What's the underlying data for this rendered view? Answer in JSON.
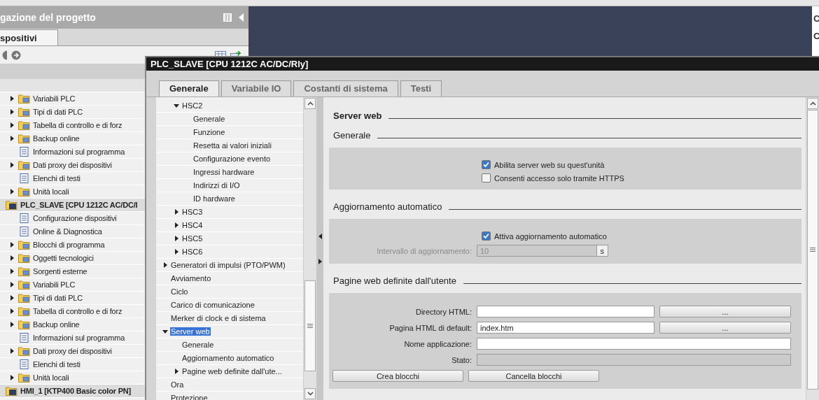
{
  "project_panel": {
    "title": "gazione del progetto",
    "tab": "spositivi",
    "tree": [
      {
        "children": [
          {
            "label": "Variabili PLC",
            "kind": "folder",
            "expanded": false
          },
          {
            "label": "Tipi di dati PLC",
            "kind": "folder",
            "expanded": false
          },
          {
            "label": "Tabella di controllo e di forz",
            "kind": "folder",
            "expanded": false
          },
          {
            "label": "Backup online",
            "kind": "folder",
            "expanded": false
          },
          {
            "label": "Informazioni sul programma",
            "kind": "document"
          },
          {
            "label": "Dati proxy dei dispositivi",
            "kind": "folder",
            "expanded": false
          },
          {
            "label": "Elenchi di testi",
            "kind": "document"
          },
          {
            "label": "Unità locali",
            "kind": "folder",
            "expanded": false
          }
        ]
      },
      {
        "label": "PLC_SLAVE [CPU 1212C AC/DC/I",
        "kind": "device",
        "children": [
          {
            "label": "Configurazione dispositivi",
            "kind": "document"
          },
          {
            "label": "Online & Diagnostica",
            "kind": "document"
          },
          {
            "label": "Blocchi di programma",
            "kind": "folder",
            "expanded": false
          },
          {
            "label": "Oggetti tecnologici",
            "kind": "folder",
            "expanded": false
          },
          {
            "label": "Sorgenti esterne",
            "kind": "folder",
            "expanded": false
          },
          {
            "label": "Variabili PLC",
            "kind": "folder",
            "expanded": false
          },
          {
            "label": "Tipi di dati PLC",
            "kind": "folder",
            "expanded": false
          },
          {
            "label": "Tabella di controllo e di forz",
            "kind": "folder",
            "expanded": false
          },
          {
            "label": "Backup online",
            "kind": "folder",
            "expanded": false
          },
          {
            "label": "Informazioni sul programma",
            "kind": "document"
          },
          {
            "label": "Dati proxy dei dispositivi",
            "kind": "folder",
            "expanded": false
          },
          {
            "label": "Elenchi di testi",
            "kind": "document"
          },
          {
            "label": "Unità locali",
            "kind": "folder",
            "expanded": false
          }
        ]
      },
      {
        "label": "HMI_1 [KTP400 Basic color PN]",
        "kind": "device"
      }
    ]
  },
  "side_panel": {
    "labels": [
      "C",
      "C"
    ]
  },
  "dialog": {
    "title": "PLC_SLAVE [CPU 1212C AC/DC/Rly]",
    "tabs": [
      {
        "label": "Generale",
        "selected": true
      },
      {
        "label": "Variabile IO",
        "selected": false
      },
      {
        "label": "Costanti di sistema",
        "selected": false
      },
      {
        "label": "Testi",
        "selected": false
      }
    ],
    "nav": [
      {
        "children": [
          {
            "label": "HSC2",
            "expanded": true,
            "selected": false,
            "children": [
              {
                "label": "Generale",
                "selected": false
              },
              {
                "label": "Funzione",
                "selected": false
              },
              {
                "label": "Resetta ai valori iniziali",
                "selected": false
              },
              {
                "label": "Configurazione evento",
                "selected": false
              },
              {
                "label": "Ingressi hardware",
                "selected": false
              },
              {
                "label": "Indirizzi di I/O",
                "selected": false
              },
              {
                "label": "ID hardware",
                "selected": false
              }
            ]
          },
          {
            "label": "HSC3",
            "expanded": false,
            "selected": false
          },
          {
            "label": "HSC4",
            "expanded": false,
            "selected": false
          },
          {
            "label": "HSC5",
            "expanded": false,
            "selected": false
          },
          {
            "label": "HSC6",
            "expanded": false,
            "selected": false
          }
        ]
      },
      {
        "label": "Generatori di impulsi (PTO/PWM)",
        "expanded": false,
        "selected": false
      },
      {
        "label": "Avviamento",
        "selected": false
      },
      {
        "label": "Ciclo",
        "selected": false
      },
      {
        "label": "Carico di comunicazione",
        "selected": false
      },
      {
        "label": "Merker di clock e di sistema",
        "selected": false
      },
      {
        "label": "Server web",
        "expanded": true,
        "selected": true,
        "children": [
          {
            "label": "Generale",
            "selected": false
          },
          {
            "label": "Aggiornamento automatico",
            "selected": false
          },
          {
            "label": "Pagine web definite dall'ute...",
            "expanded": false,
            "selected": false
          }
        ]
      },
      {
        "label": "Ora",
        "selected": false
      },
      {
        "label": "Protezione",
        "selected": false
      }
    ],
    "content": {
      "title": "Server web",
      "sections": [
        {
          "title": "Generale",
          "rows": [
            {
              "kind": "checkbox",
              "label": "Abilita server web su quest'unità",
              "checked": true
            },
            {
              "kind": "checkbox",
              "label": "Consenti accesso solo tramite HTTPS",
              "checked": false
            }
          ]
        },
        {
          "title": "Aggiornamento automatico",
          "rows": [
            {
              "kind": "checkbox",
              "label": "Attiva aggiornamento automatico",
              "checked": true
            },
            {
              "kind": "number",
              "label": "Intervallo di aggiornamento:",
              "value": "10",
              "unit": "s",
              "disabled": true
            }
          ]
        },
        {
          "title": "Pagine web definite dall'utente",
          "rows": [
            {
              "kind": "path",
              "label": "Directory HTML:",
              "button": "..."
            },
            {
              "kind": "path",
              "label": "Pagina HTML di default:",
              "value": "index.htm",
              "button": "..."
            },
            {
              "kind": "text",
              "label": "Nome applicazione:",
              "readonly": false
            },
            {
              "kind": "text",
              "label": "Stato:",
              "readonly": true
            },
            {
              "kind": "buttons",
              "buttons": [
                "Crea blocchi",
                "Cancella blocchi"
              ]
            }
          ]
        }
      ]
    }
  }
}
